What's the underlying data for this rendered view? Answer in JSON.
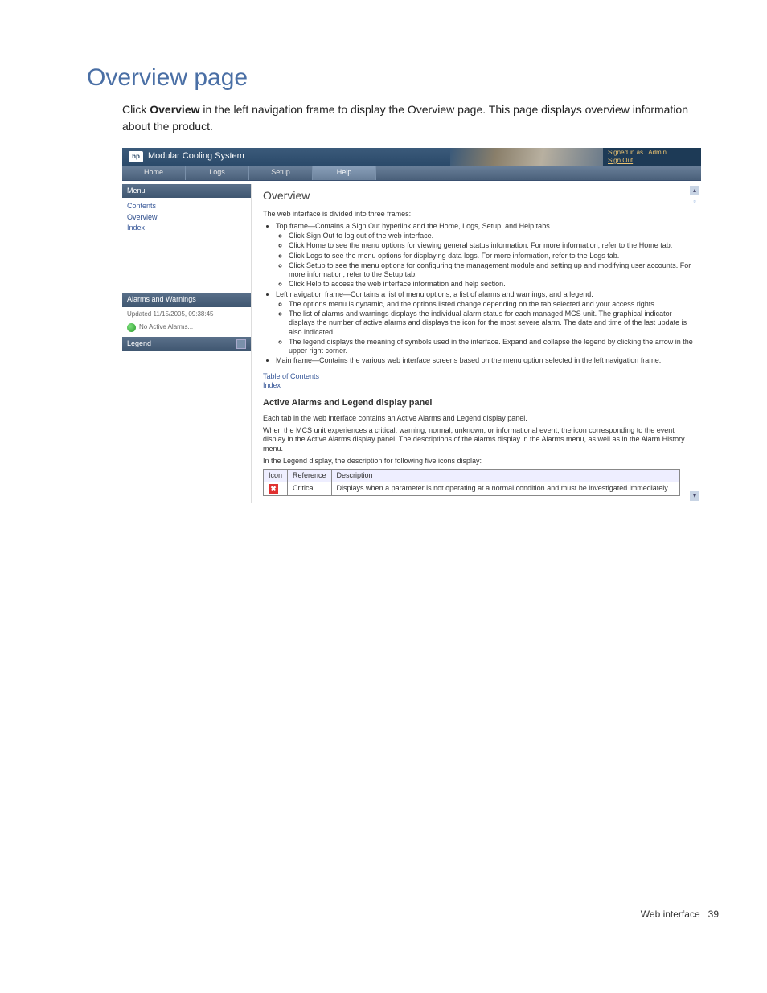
{
  "page": {
    "heading": "Overview page",
    "intro_pre": "Click ",
    "intro_bold": "Overview",
    "intro_post": " in the left navigation frame to display the Overview page. This page displays overview information about the product."
  },
  "app": {
    "logo_text": "hp",
    "title": "Modular Cooling System",
    "signed_in": "Signed in as : Admin",
    "sign_out": "Sign Out"
  },
  "tabs": {
    "home": "Home",
    "logs": "Logs",
    "setup": "Setup",
    "help": "Help"
  },
  "sidebar": {
    "menu_hd": "Menu",
    "contents": "Contents",
    "overview": "Overview",
    "index": "Index",
    "alarms_hd": "Alarms and Warnings",
    "updated": "Updated 11/15/2005, 09:38:45",
    "no_alarms": "No Active Alarms...",
    "legend_hd": "Legend"
  },
  "content": {
    "h1": "Overview",
    "p_intro": "The web interface is divided into three frames:",
    "top_frame": "Top frame—Contains a Sign Out hyperlink and the Home, Logs, Setup, and Help tabs.",
    "top_a": "Click Sign Out to log out of the web interface.",
    "top_b": "Click Home to see the menu options for viewing general status information. For more information, refer to the Home tab.",
    "top_c": "Click Logs to see the menu options for displaying data logs. For more information, refer to the Logs tab.",
    "top_d": "Click Setup to see the menu options for configuring the management module and setting up and modifying user accounts. For more information, refer to the Setup tab.",
    "top_e": "Click Help to access the web interface information and help section.",
    "left_frame": "Left navigation frame—Contains a list of menu options, a list of alarms and warnings, and a legend.",
    "left_a": "The options menu is dynamic, and the options listed change depending on the tab selected and your access rights.",
    "left_b": "The list of alarms and warnings displays the individual alarm status for each managed MCS unit. The graphical indicator displays the number of active alarms and displays the icon for the most severe alarm. The date and time of the last update is also indicated.",
    "left_c": "The legend displays the meaning of symbols used in the interface. Expand and collapse the legend by clicking the arrow in the upper right corner.",
    "main_frame": "Main frame—Contains the various web interface screens based on the menu option selected in the left navigation frame.",
    "toc": "Table of Contents",
    "idx": "Index",
    "h2": "Active Alarms and Legend display panel",
    "p2": "Each tab in the web interface contains an Active Alarms and Legend display panel.",
    "p3": "When the MCS unit experiences a critical, warning, normal, unknown, or informational event, the icon corresponding to the event display in the Active Alarms display panel. The descriptions of the alarms display in the Alarms menu, as well as in the Alarm History menu.",
    "p4": "In the Legend display, the description for following five icons display:"
  },
  "table": {
    "h_icon": "Icon",
    "h_ref": "Reference",
    "h_desc": "Description",
    "row1_ref": "Critical",
    "row1_desc": "Displays when a parameter is not operating at a normal condition and must be investigated immediately"
  },
  "footer": {
    "section": "Web interface",
    "page_no": "39"
  }
}
